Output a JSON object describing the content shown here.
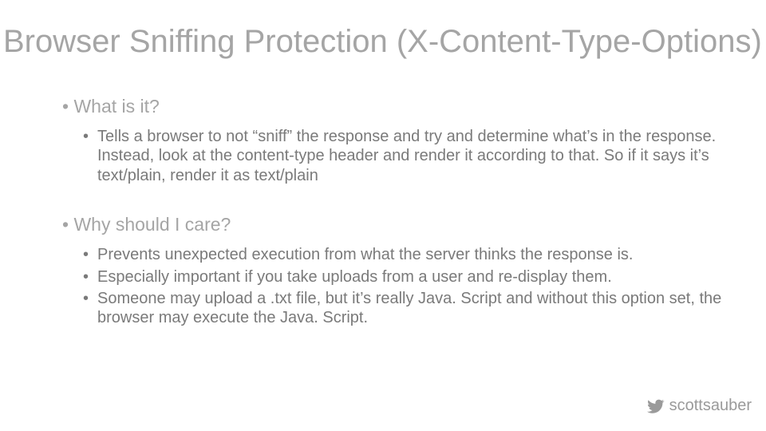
{
  "title": "Browser Sniffing Protection (X-Content-Type-Options)",
  "sections": {
    "s0": {
      "heading": "What is it?",
      "items": {
        "i0": "Tells a browser to not “sniff” the response and try and determine what’s in the response.  Instead, look at the content-type header and render it according to that.  So if it says it’s text/plain, render it as text/plain"
      }
    },
    "s1": {
      "heading": "Why should I care?",
      "items": {
        "i0": "Prevents unexpected execution from what the server thinks the response is.",
        "i1": "Especially important if you take uploads from a user and re-display them.",
        "i2": "Someone may upload a .txt file, but it’s really Java. Script and without this option set, the browser may execute the Java. Script."
      }
    }
  },
  "footer": {
    "handle": "scottsauber"
  },
  "bullet": "•"
}
